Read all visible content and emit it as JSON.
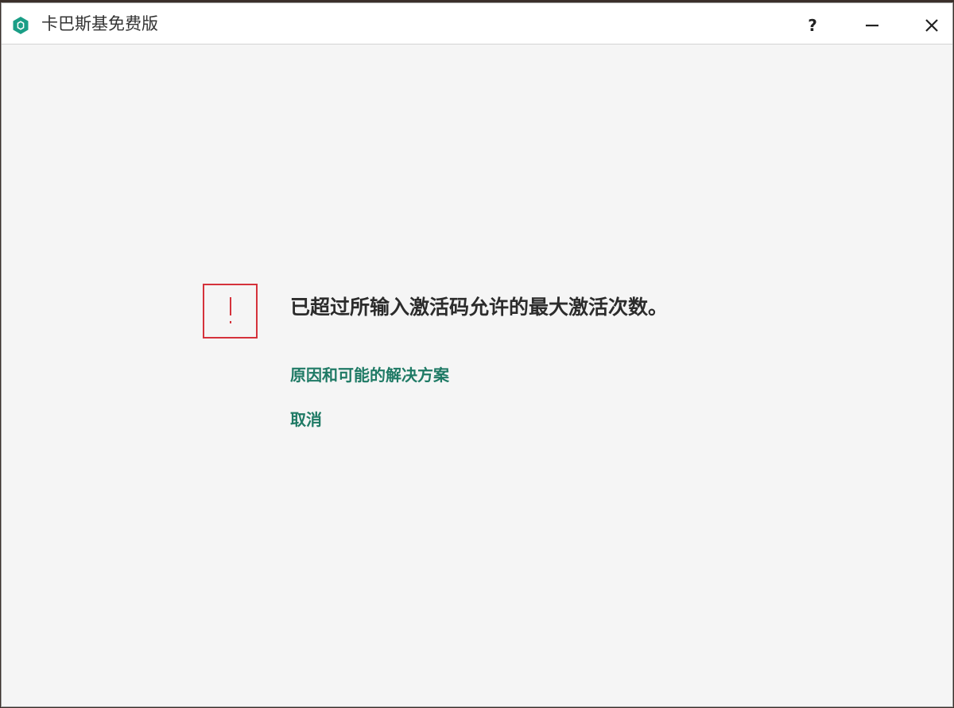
{
  "window": {
    "title": "卡巴斯基免费版",
    "help_label": "?"
  },
  "icons": {
    "app": "kaspersky-hexagon-icon",
    "help": "question-mark-icon",
    "minimize": "minimize-icon",
    "close": "close-icon",
    "alert": "exclamation-icon"
  },
  "colors": {
    "brand": "#1a9e86",
    "link": "#1f7a65",
    "alert": "#d5323b",
    "background": "#f5f5f5"
  },
  "main": {
    "message": "已超过所输入激活码允许的最大激活次数。",
    "reasons_link": "原因和可能的解决方案",
    "cancel_link": "取消"
  }
}
